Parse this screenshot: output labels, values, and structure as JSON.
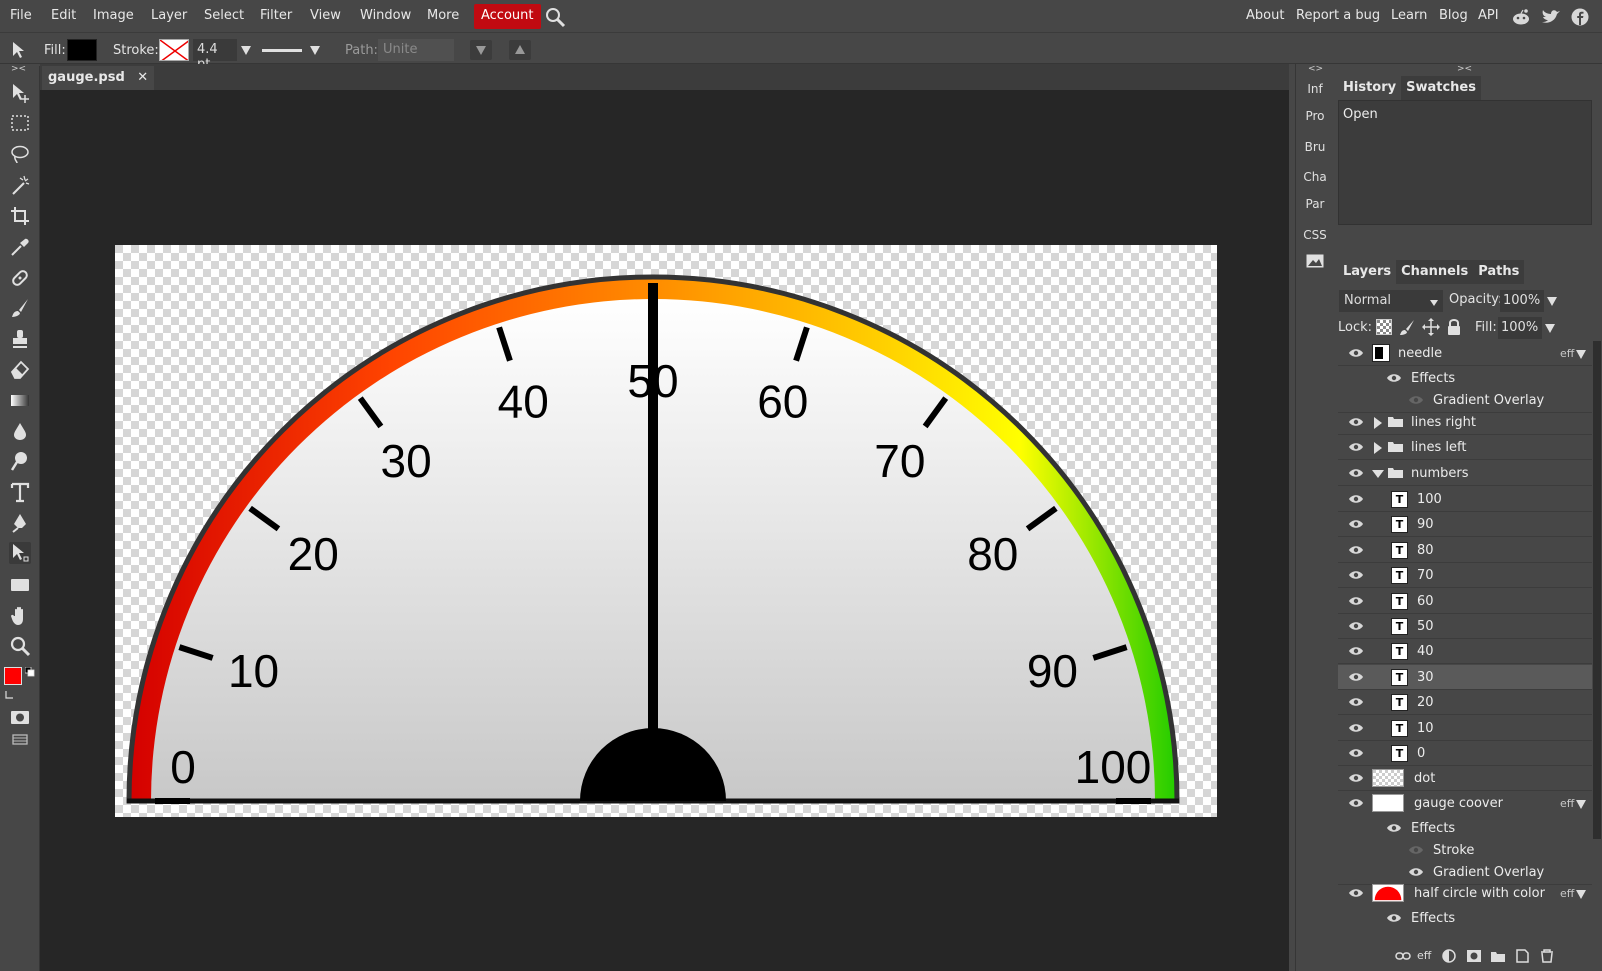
{
  "menu": {
    "file": "File",
    "edit": "Edit",
    "image": "Image",
    "layer": "Layer",
    "select": "Select",
    "filter": "Filter",
    "view": "View",
    "window": "Window",
    "more": "More",
    "account": "Account",
    "about": "About",
    "report_bug": "Report a bug",
    "learn": "Learn",
    "blog": "Blog",
    "api": "API"
  },
  "options": {
    "fill_label": "Fill:",
    "stroke_label": "Stroke:",
    "stroke_width": "4.4 pt",
    "path_label": "Path:",
    "path_mode": "Unite"
  },
  "document": {
    "tab_title": "gauge.psd"
  },
  "gauge": {
    "numbers": [
      "0",
      "10",
      "20",
      "30",
      "40",
      "50",
      "60",
      "70",
      "80",
      "90",
      "100"
    ],
    "needle_value": 50,
    "gradient_colors": [
      "#d40000",
      "#ff4400",
      "#ff8c00",
      "#ffd000",
      "#ffff00",
      "#22cc00"
    ]
  },
  "mini_panel": [
    "Inf",
    "Pro",
    "Bru",
    "Cha",
    "Par",
    "CSS"
  ],
  "history_panel": {
    "tabs": [
      "History",
      "Swatches"
    ],
    "items": [
      "Open"
    ]
  },
  "layers_panel": {
    "tabs": [
      "Layers",
      "Channels",
      "Paths"
    ],
    "blend_mode": "Normal",
    "opacity_label": "Opacity:",
    "opacity": "100%",
    "lock_label": "Lock:",
    "fill_label": "Fill:",
    "fill": "100%",
    "eff_tag": "eff",
    "layers": {
      "needle": "needle",
      "needle_effects": "Effects",
      "needle_gradient": "Gradient Overlay",
      "lines_right": "lines right",
      "lines_left": "lines left",
      "numbers": "numbers",
      "n100": "100",
      "n90": "90",
      "n80": "80",
      "n70": "70",
      "n60": "60",
      "n50": "50",
      "n40": "40",
      "n30": "30",
      "n20": "20",
      "n10": "10",
      "n0": "0",
      "dot": "dot",
      "gauge_cover": "gauge coover",
      "gc_effects": "Effects",
      "gc_stroke": "Stroke",
      "gc_gradient": "Gradient Overlay",
      "half_circle": "half circle with color",
      "hc_effects": "Effects"
    },
    "selected_layer": "30"
  },
  "footer": {
    "eff": "eff"
  }
}
